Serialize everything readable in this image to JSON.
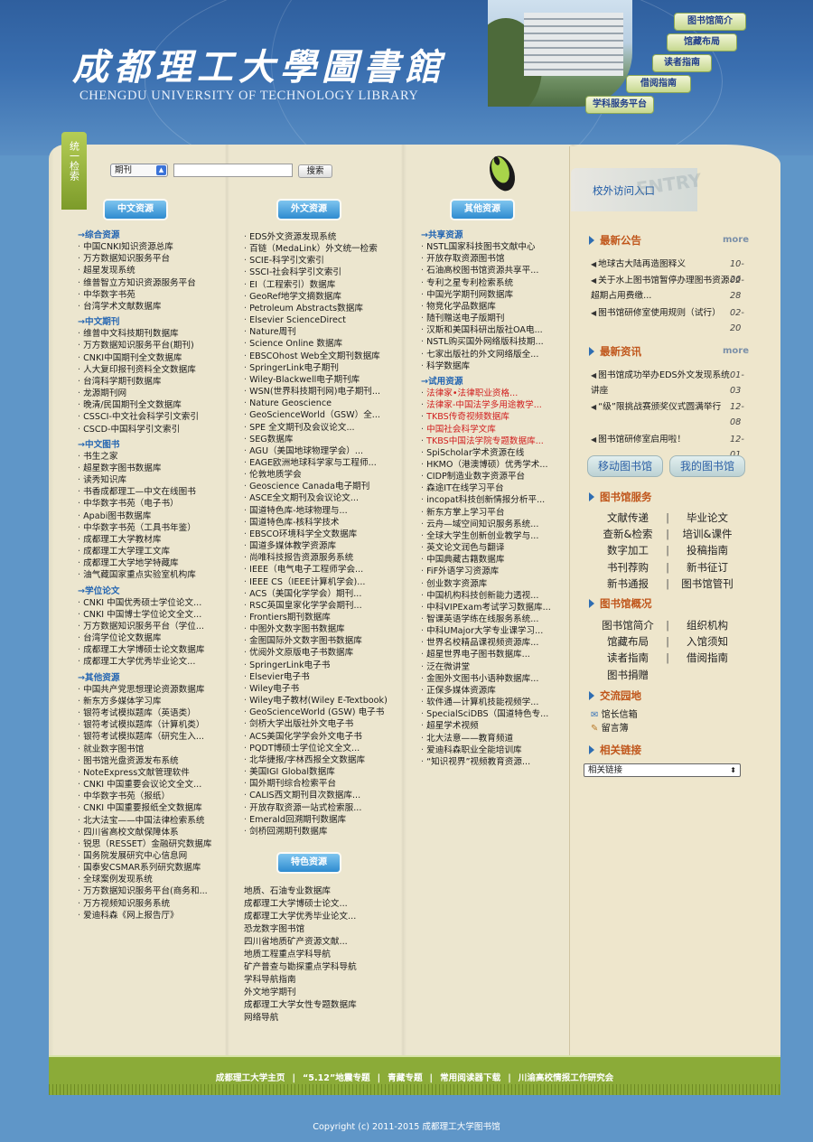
{
  "header": {
    "logo_cn": "成都理工大學圖書館",
    "logo_en": "CHENGDU UNIVERSITY OF TECHNOLOGY LIBRARY",
    "nav": [
      "图书馆简介",
      "馆藏布局",
      "读者指南",
      "借阅指南",
      "学科服务平台"
    ]
  },
  "search": {
    "tab_label": "统一检索",
    "select_value": "期刊",
    "button": "搜索"
  },
  "columns": {
    "chinese": {
      "header": "中文资源",
      "sections": [
        {
          "title": "→综合资源",
          "items": [
            "中国CNKI知识资源总库",
            "万方数据知识服务平台",
            "超星发现系统",
            "维普智立方知识资源服务平台",
            "中华数字书苑",
            "台湾学术文献数据库"
          ]
        },
        {
          "title": "→中文期刊",
          "items": [
            "维普中文科技期刊数据库",
            "万方数据知识服务平台(期刊)",
            "CNKI中国期刊全文数据库",
            "人大复印报刊资料全文数据库",
            "台湾科学期刊数据库",
            "龙源期刊网",
            "晚清/民国期刊全文数据库",
            "CSSCI-中文社会科学引文索引",
            "CSCD-中国科学引文索引"
          ]
        },
        {
          "title": "→中文图书",
          "items": [
            "书生之家",
            "超星数字图书数据库",
            "读秀知识库",
            "书香成都理工—中文在线图书",
            "中华数字书苑（电子书）",
            "Apabi图书数据库",
            "中华数字书苑（工具书年鉴）",
            "成都理工大学教材库",
            "成都理工大学理工文库",
            "成都理工大学地学特藏库",
            "油气藏国家重点实验室机构库"
          ]
        },
        {
          "title": "→学位论文",
          "items": [
            "CNKI 中国优秀硕士学位论文...",
            "CNKI 中国博士学位论文全文...",
            "万方数据知识服务平台（学位...",
            "台湾学位论文数据库",
            "成都理工大学博硕士论文数据库",
            "成都理工大学优秀毕业论文..."
          ]
        },
        {
          "title": "→其他资源",
          "items": [
            "中国共产党思想理论资源数据库",
            "新东方多媒体学习库",
            "银符考试模拟题库（英语类）",
            "银符考试模拟题库（计算机类）",
            "银符考试模拟题库（研究生入...",
            "就业数字图书馆",
            "图书馆光盘资源发布系统",
            "NoteExpress文献管理软件",
            "CNKI 中国重要会议论文全文...",
            "中华数字书苑（报纸）",
            "CNKI 中国重要报纸全文数据库",
            "北大法宝——中国法律检索系统",
            "四川省高校文献保障体系",
            "锐思（RESSET）金融研究数据库",
            "国务院发展研究中心信息网",
            "国泰安CSMAR系列研究数据库",
            "全球案例发现系统",
            "万方数据知识服务平台(商务和...",
            "万方视频知识服务系统",
            "爱迪科森《网上报告厅》"
          ]
        }
      ]
    },
    "foreign": {
      "header": "外文资源",
      "items": [
        "EDS外文资源发现系统",
        "百链（MedaLink）外文统一检索",
        "SCIE-科学引文索引",
        "SSCI-社会科学引文索引",
        "EI（工程索引）数据库",
        "GeoRef地学文摘数据库",
        "Petroleum Abstracts数据库",
        "Elsevier ScienceDirect",
        "Nature周刊",
        "Science Online 数据库",
        "EBSCOhost Web全文期刊数据库",
        "SpringerLink电子期刊",
        "Wiley-Blackwell电子期刊库",
        "WSN(世界科技期刊网)电子期刊...",
        "Nature Geoscience",
        "GeoScienceWorld（GSW）全...",
        "SPE 全文期刊及会议论文...",
        "SEG数据库",
        "AGU（美国地球物理学会）...",
        "EAGE欧洲地球科学家与工程师...",
        "伦敦地质学会",
        "Geoscience Canada电子期刊",
        "ASCE全文期刊及会议论文...",
        "国道特色库-地球物理与...",
        "国道特色库-核科学技术",
        "EBSCO环境科学全文数据库",
        "国道多媒体教学资源库",
        "尚唯科技报告资源服务系统",
        "IEEE（电气电子工程师学会...",
        "IEEE CS（IEEE计算机学会)...",
        "ACS（美国化学学会）期刊...",
        "RSC英国皇家化学学会期刊...",
        "Frontiers期刊数据库",
        "中图外文数字图书数据库",
        "金图国际外文数字图书数据库",
        "优阅外文原版电子书数据库",
        "SpringerLink电子书",
        "Elsevier电子书",
        "Wiley电子书",
        "Wiley电子教材(Wiley E-Textbook)",
        "GeoScienceWorld (GSW) 电子书",
        "剑桥大学出版社外文电子书",
        "ACS美国化学学会外文电子书",
        "PQDT博硕士学位论文全文...",
        "北华捷报/字林西报全文数据库",
        "美国IGI Global数据库",
        "国外期刊综合检索平台",
        "CALIS西文期刊目次数据库...",
        "开放存取资源一站式检索服...",
        "Emerald回溯期刊数据库",
        "剑桥回溯期刊数据库"
      ]
    },
    "other": {
      "header": "其他资源",
      "sections": [
        {
          "title": "→共享资源",
          "items": [
            "NSTL国家科技图书文献中心",
            "开放存取资源图书馆",
            "石油高校图书馆资源共享平...",
            "专利之星专利检索系统",
            "中国光学期刊网数据库",
            "物竞化学品数据库",
            "随刊赠送电子版期刊",
            "汉斯和美国科研出版社OA电...",
            "NSTL购买国外网络版科技期...",
            "七家出版社的外文网络版全...",
            "科学数据库"
          ]
        },
        {
          "title": "→试用资源",
          "items": [
            "法律家•法律职业资格...",
            "法律家-中国法学多用途教学...",
            "TKBS传奇视频数据库",
            "中国社会科学文库",
            "TKBS中国法学院专题数据库...",
            "SpiScholar学术资源在线",
            "HKMO（港澳博硕）优秀学术...",
            "CIDP制造业数字资源平台",
            "森途IT在线学习平台",
            "incopat科技创新情报分析平...",
            "新东方掌上学习平台",
            "云舟—域空间知识服务系统...",
            "全球大学生创新创业教学与...",
            "英文论文润色与翻译",
            "中国典藏古籍数据库",
            "FiF外语学习资源库",
            "创业数字资源库",
            "中国机构科技创新能力透视...",
            "中科VIPExam考试学习数据库...",
            "智课英语学练在线服务系统...",
            "中科UMajor大学专业课学习...",
            "世界名校精品课视频资源库...",
            "超星世界电子图书数据库...",
            "泛在微讲堂",
            "金图外文图书小语种数据库...",
            "正保多媒体资源库",
            "软件通—计算机技能视频学...",
            "SpecialSciDBS（国道特色专...",
            "超星学术视频",
            "北大法意——教育频道",
            "爱迪科森职业全能培训库",
            "“知识视界”视频教育资源..."
          ],
          "red_count": 5
        }
      ]
    },
    "special": {
      "header": "特色资源",
      "items": [
        "地质、石油专业数据库",
        "成都理工大学博硕士论文...",
        "成都理工大学优秀毕业论文...",
        "恐龙数字图书馆",
        "四川省地质矿产资源文献...",
        "地质工程重点学科导航",
        "矿产普查与勘探重点学科导航",
        "学科导航指南",
        "外文地学期刊",
        "成都理工大学女性专题数据库",
        "网络导航"
      ]
    }
  },
  "right": {
    "visit": "校外访问入口",
    "visit_ghost": "ENTRY",
    "announce_title": "最新公告",
    "more": "more",
    "announcements": [
      {
        "text": "地球古大陆再造图释义",
        "date": "10-26"
      },
      {
        "text": "关于水上图书馆暂停办理图书资源超期占用费缴...",
        "date": "02-28"
      },
      {
        "text": "图书馆研修室使用规则（试行）",
        "date": "02-20"
      }
    ],
    "news_title": "最新资讯",
    "news": [
      {
        "text": "图书馆成功举办EDS外文发现系统讲座",
        "date": "01-03"
      },
      {
        "text": "“级”限挑战赛颁奖仪式圆满举行",
        "date": "12-08"
      },
      {
        "text": "图书馆研修室启用啦！",
        "date": "12-01"
      }
    ],
    "btn_mobile": "移动图书馆",
    "btn_my": "我的图书馆",
    "services_title": "图书馆服务",
    "services": [
      [
        "文献传递",
        "毕业论文"
      ],
      [
        "查新&检索",
        "培训&课件"
      ],
      [
        "数字加工",
        "投稿指南"
      ],
      [
        "书刊荐购",
        "新书征订"
      ],
      [
        "新书通报",
        "图书馆管刊"
      ]
    ],
    "overview_title": "图书馆概况",
    "overview": [
      [
        "图书馆简介",
        "组织机构"
      ],
      [
        "馆藏布局",
        "入馆须知"
      ],
      [
        "读者指南",
        "借阅指南"
      ],
      [
        "图书捐赠",
        ""
      ]
    ],
    "exchange_title": "交流园地",
    "exchange": [
      "馆长信箱",
      "留言簿"
    ],
    "related_title": "相关链接",
    "related_select": "相关链接"
  },
  "footer": {
    "links": [
      "成都理工大学主页",
      "“5.12”地震专题",
      "青藏专题",
      "常用阅读器下载",
      "川渝高校情报工作研究会"
    ],
    "copyright": "Copyright (c) 2011-2015 成都理工大学图书馆"
  }
}
